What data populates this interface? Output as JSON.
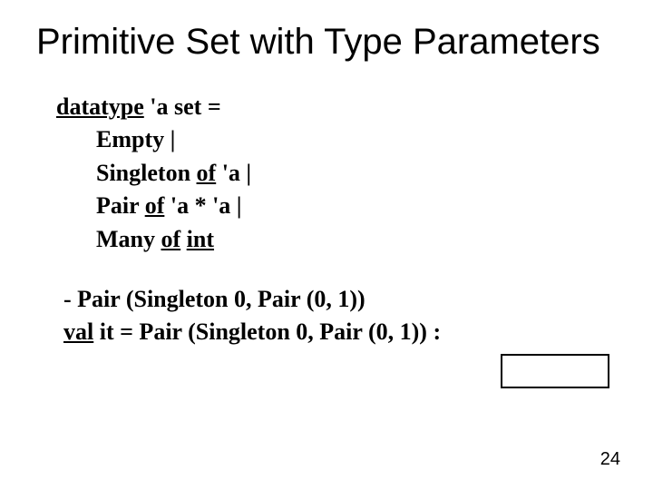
{
  "title": "Primitive Set with Type Parameters",
  "decl": {
    "kw_datatype": "datatype",
    "head_rest": " 'a set =",
    "empty": "Empty |",
    "singleton_pre": "Singleton ",
    "of": "of",
    "singleton_post": " 'a |",
    "pair_pre": "Pair ",
    "pair_post": " 'a * 'a |",
    "many_pre": "Many ",
    "int": "int"
  },
  "repl": {
    "input": "- Pair (Singleton 0, Pair (0, 1))",
    "out_pre": "val",
    "out_post": " it = Pair (Singleton 0, Pair (0, 1)) :"
  },
  "page_number": "24"
}
